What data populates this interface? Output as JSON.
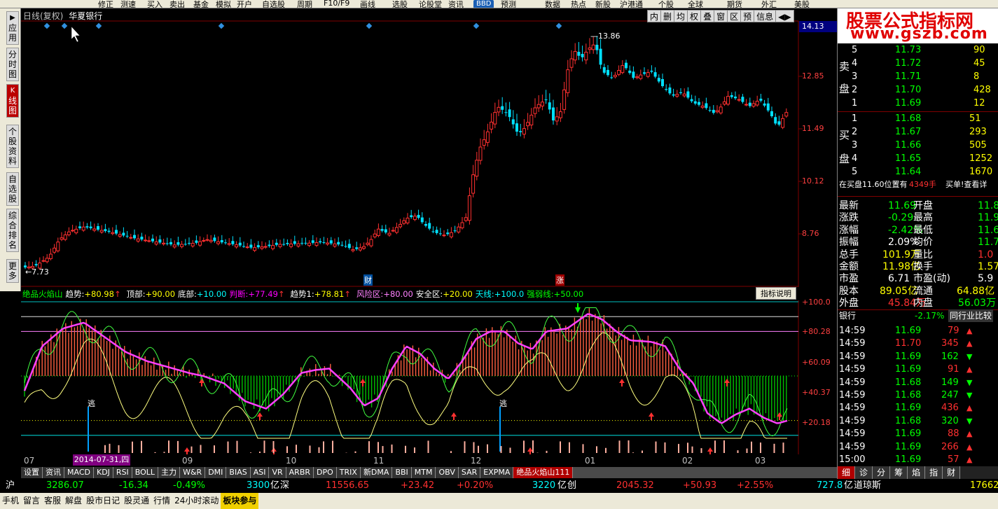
{
  "toolbar": {
    "items": [
      "修正",
      "测速",
      "买入",
      "卖出",
      "基金",
      "模拟",
      "开户",
      "自选股",
      "周期",
      "F10/F9",
      "画线",
      "选股",
      "论股堂",
      "资讯",
      "预测",
      "数据",
      "热点",
      "新股",
      "沪港通",
      "个股",
      "全球",
      "期货",
      "外汇",
      "美股"
    ],
    "bbd": "BBD"
  },
  "left_tabs": [
    {
      "label": "应用",
      "icon": "▶"
    },
    {
      "label": "分时图",
      "icon": ""
    },
    {
      "label": "线图",
      "icon": "K"
    },
    {
      "label": "个股资料",
      "icon": ""
    },
    {
      "label": "自选股",
      "icon": ""
    },
    {
      "label": "综合排名",
      "icon": ""
    },
    {
      "label": "更多",
      "icon": ""
    }
  ],
  "main_chart": {
    "title": "日线(复权)",
    "stock_name": "华夏银行",
    "price_labels": [
      "12.85",
      "11.49",
      "10.12",
      "8.76"
    ],
    "current_price": "14.13",
    "high_label": "13.86",
    "low_label": "7.73",
    "buttons": [
      "内",
      "删",
      "均",
      "权",
      "叠",
      "窗",
      "区",
      "预",
      "信息",
      "◀▶"
    ],
    "markers": {
      "cai": "财",
      "zhang": "涨"
    }
  },
  "indicator": {
    "name": "绝品火焰山",
    "fields": [
      {
        "label": "趋势:",
        "value": "+80.98",
        "arrow": "↑",
        "color": "#ffffff",
        "vcolor": "#ffff00"
      },
      {
        "label": "顶部:",
        "value": "+90.00",
        "arrow": "",
        "color": "#ffffff",
        "vcolor": "#ffff00"
      },
      {
        "label": "底部:",
        "value": "+10.00",
        "arrow": "",
        "color": "#ffffff",
        "vcolor": "#00ffff"
      },
      {
        "label": "判断:",
        "value": "+77.49",
        "arrow": "↑",
        "color": "#ff00ff",
        "vcolor": "#ff00ff"
      },
      {
        "label": "趋势1:",
        "value": "+78.81",
        "arrow": "↑",
        "color": "#ffffff",
        "vcolor": "#ffff00"
      },
      {
        "label": "风险区:",
        "value": "+80.00",
        "arrow": "",
        "color": "#ff80ff",
        "vcolor": "#ff80ff"
      },
      {
        "label": "安全区:",
        "value": "+20.00",
        "arrow": "",
        "color": "#ffffff",
        "vcolor": "#ffff00"
      },
      {
        "label": "天线:",
        "value": "+100.0",
        "arrow": "",
        "color": "#00ffff",
        "vcolor": "#00ffff"
      },
      {
        "label": "强弱线:",
        "value": "+50.00",
        "arrow": "",
        "color": "#00ff00",
        "vcolor": "#00ff00"
      }
    ],
    "explain_button": "指标说明",
    "axis_labels": [
      "+100.0",
      "+80.28",
      "+60.09",
      "+40.37",
      "+20.18"
    ],
    "escape_label": "逃"
  },
  "x_axis": {
    "labels": [
      "07",
      "09",
      "10",
      "11",
      "12",
      "01",
      "02",
      "03"
    ],
    "cursor_date": "2014-07-31,四"
  },
  "bottom_tabs": [
    "设置",
    "资讯",
    "MACD",
    "KDJ",
    "RSI",
    "BOLL",
    "主力",
    "W&R",
    "DMI",
    "BIAS",
    "ASI",
    "VR",
    "ARBR",
    "DPO",
    "TRIX",
    "新DMA",
    "BBI",
    "MTM",
    "OBV",
    "SAR",
    "EXPMA",
    "绝品火焰山111"
  ],
  "status": {
    "sh_label": "沪",
    "sh_index": "3286.07",
    "sh_change": "-16.34",
    "sh_pct": "-0.49%",
    "sh_amount": "3300",
    "yi": "亿",
    "sz_label": "深",
    "sz_index": "11556.65",
    "sz_change": "+23.42",
    "sz_pct": "+0.20%",
    "sz_amount": "3220",
    "cy_label": "创",
    "cy_index": "2045.32",
    "cy_change": "+50.93",
    "cy_pct": "+2.55%",
    "cy_amount": "727.8",
    "dj_label": "道琼斯",
    "dj_index": "17662"
  },
  "bottom_bar": [
    "手机",
    "留言",
    "客服",
    "解盘",
    "股市日记",
    "股灵通",
    "行情",
    "24小时滚动",
    "板块参与"
  ],
  "right_panel": {
    "logo_line1": "股票公式指标网",
    "logo_line2": "www.gszb.com",
    "sell_label": [
      "卖",
      "盘"
    ],
    "buy_label": [
      "买",
      "盘"
    ],
    "sell": [
      {
        "lvl": "5",
        "price": "11.73",
        "vol": "90"
      },
      {
        "lvl": "4",
        "price": "11.72",
        "vol": "45"
      },
      {
        "lvl": "3",
        "price": "11.71",
        "vol": "8"
      },
      {
        "lvl": "2",
        "price": "11.70",
        "vol": "428"
      },
      {
        "lvl": "1",
        "price": "11.69",
        "vol": "12"
      }
    ],
    "buy": [
      {
        "lvl": "1",
        "price": "11.68",
        "vol": "51"
      },
      {
        "lvl": "2",
        "price": "11.67",
        "vol": "293"
      },
      {
        "lvl": "3",
        "price": "11.66",
        "vol": "505"
      },
      {
        "lvl": "4",
        "price": "11.65",
        "vol": "1252"
      },
      {
        "lvl": "5",
        "price": "11.64",
        "vol": "1670"
      }
    ],
    "order_note": "在买盘11.60位置有",
    "order_qty": "4349手",
    "order_link": "买单!查看详",
    "quote": [
      {
        "l1": "最新",
        "v1": "11.69",
        "c1": "grn",
        "l2": "开盘",
        "v2": "11.8",
        "c2": "grn"
      },
      {
        "l1": "涨跌",
        "v1": "-0.29",
        "c1": "grn",
        "l2": "最高",
        "v2": "11.9",
        "c2": "grn"
      },
      {
        "l1": "涨幅",
        "v1": "-2.42%",
        "c1": "grn",
        "l2": "最低",
        "v2": "11.6",
        "c2": "grn"
      },
      {
        "l1": "振幅",
        "v1": "2.09%",
        "c1": "wht",
        "l2": "均价",
        "v2": "11.7",
        "c2": "grn"
      },
      {
        "l1": "总手",
        "v1": "101.9万",
        "c1": "yel",
        "l2": "量比",
        "v2": "1.0",
        "c2": "red"
      },
      {
        "l1": "金额",
        "v1": "11.98亿",
        "c1": "yel",
        "l2": "换手",
        "v2": "1.57",
        "c2": "yel"
      },
      {
        "l1": "市盈",
        "v1": "6.71",
        "c1": "wht",
        "l2": "市盈(动)",
        "v2": "5.9",
        "c2": "wht"
      },
      {
        "l1": "股本",
        "v1": "89.05亿",
        "c1": "yel",
        "l2": "流通",
        "v2": "64.88亿",
        "c2": "yel"
      },
      {
        "l1": "外盘",
        "v1": "45.84万",
        "c1": "red",
        "l2": "内盘",
        "v2": "56.03万",
        "c2": "grn"
      }
    ],
    "sector_name": "银行",
    "sector_pct": "-2.17%",
    "sector_btn": "同行业比较",
    "ticks": [
      {
        "t": "14:59",
        "p": "11.69",
        "v": "79",
        "d": "up"
      },
      {
        "t": "14:59",
        "p": "11.70",
        "v": "345",
        "d": "up"
      },
      {
        "t": "14:59",
        "p": "11.69",
        "v": "162",
        "d": "down"
      },
      {
        "t": "14:59",
        "p": "11.69",
        "v": "91",
        "d": "up"
      },
      {
        "t": "14:59",
        "p": "11.68",
        "v": "149",
        "d": "down"
      },
      {
        "t": "14:59",
        "p": "11.68",
        "v": "247",
        "d": "down"
      },
      {
        "t": "14:59",
        "p": "11.69",
        "v": "436",
        "d": "up"
      },
      {
        "t": "14:59",
        "p": "11.68",
        "v": "320",
        "d": "down"
      },
      {
        "t": "14:59",
        "p": "11.69",
        "v": "88",
        "d": "up"
      },
      {
        "t": "14:59",
        "p": "11.69",
        "v": "266",
        "d": "up"
      },
      {
        "t": "15:00",
        "p": "11.69",
        "v": "57",
        "d": "up"
      }
    ],
    "tabs": [
      "细",
      "诊",
      "分",
      "筹",
      "焰",
      "指",
      "财"
    ]
  }
}
